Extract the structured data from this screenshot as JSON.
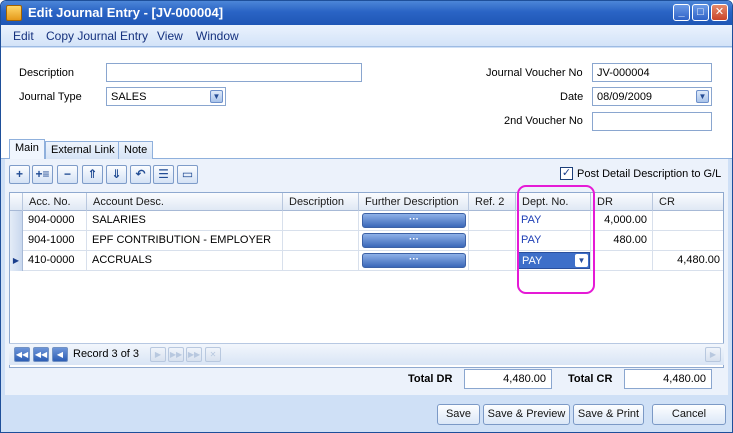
{
  "window": {
    "title": "Edit Journal Entry - [JV-000004]"
  },
  "menu": [
    "Edit",
    "Copy Journal Entry",
    "View",
    "Window"
  ],
  "form": {
    "description_label": "Description",
    "description_value": "",
    "journal_type_label": "Journal Type",
    "journal_type_value": "SALES",
    "jv_no_label": "Journal Voucher No",
    "jv_no_value": "JV-000004",
    "date_label": "Date",
    "date_value": "08/09/2009",
    "second_voucher_label": "2nd Voucher No",
    "second_voucher_value": ""
  },
  "tabs": [
    "Main",
    "External Link",
    "Note"
  ],
  "toolbar": {
    "icons": [
      "add-row-icon",
      "insert-row-icon",
      "delete-row-icon",
      "move-up-icon",
      "move-down-icon",
      "undo-icon",
      "list-icon",
      "detail-icon"
    ],
    "post_detail_label": "Post Detail Description to G/L",
    "post_detail_checked": true
  },
  "grid": {
    "columns": [
      "Acc. No.",
      "Account Desc.",
      "Description",
      "Further Description",
      "Ref. 2",
      "Dept. No.",
      "DR",
      "CR"
    ],
    "button_text": "···",
    "rows": [
      {
        "acc_no": "904-0000",
        "account_desc": "SALARIES",
        "description": "",
        "ref2": "",
        "dept_no": "PAY",
        "dr": "4,000.00",
        "cr": ""
      },
      {
        "acc_no": "904-1000",
        "account_desc": "EPF CONTRIBUTION - EMPLOYER",
        "description": "",
        "ref2": "",
        "dept_no": "PAY",
        "dr": "480.00",
        "cr": ""
      },
      {
        "acc_no": "410-0000",
        "account_desc": "ACCRUALS",
        "description": "",
        "ref2": "",
        "dept_no": "PAY",
        "dr": "",
        "cr": "4,480.00"
      }
    ]
  },
  "navigator": {
    "record_text": "Record 3 of 3"
  },
  "totals": {
    "dr_label": "Total DR",
    "dr_value": "4,480.00",
    "cr_label": "Total CR",
    "cr_value": "4,480.00"
  },
  "buttons": {
    "save": "Save",
    "save_preview": "Save & Preview",
    "save_print": "Save & Print",
    "cancel": "Cancel"
  },
  "colors": {
    "title_bar": "#2a64c5",
    "highlight": "#e51ad6",
    "dept_text": "#1e3fb5"
  }
}
